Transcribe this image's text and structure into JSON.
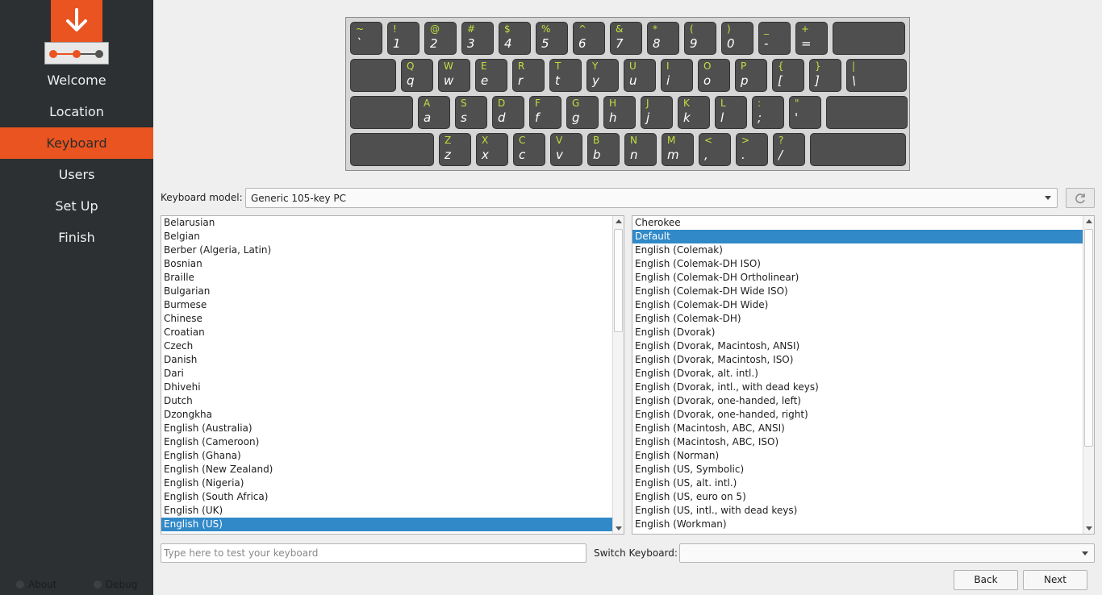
{
  "sidebar": {
    "nav": [
      {
        "label": "Welcome",
        "active": false
      },
      {
        "label": "Location",
        "active": false
      },
      {
        "label": "Keyboard",
        "active": true
      },
      {
        "label": "Users",
        "active": false
      },
      {
        "label": "Set Up",
        "active": false
      },
      {
        "label": "Finish",
        "active": false
      }
    ],
    "about_label": "About",
    "debug_label": "Debug"
  },
  "colors": {
    "accent": "#e95420",
    "sidebar_bg": "#2c3032",
    "selection": "#3189c8",
    "key_bg": "#4f4f4f",
    "key_shift_label": "#bfe040"
  },
  "keyboard_preview": {
    "rows": [
      [
        {
          "shift": "~",
          "base": "`"
        },
        {
          "shift": "!",
          "base": "1"
        },
        {
          "shift": "@",
          "base": "2"
        },
        {
          "shift": "#",
          "base": "3"
        },
        {
          "shift": "$",
          "base": "4"
        },
        {
          "shift": "%",
          "base": "5"
        },
        {
          "shift": "^",
          "base": "6"
        },
        {
          "shift": "&",
          "base": "7"
        },
        {
          "shift": "*",
          "base": "8"
        },
        {
          "shift": "(",
          "base": "9"
        },
        {
          "shift": ")",
          "base": "0"
        },
        {
          "shift": "_",
          "base": "-"
        },
        {
          "shift": "+",
          "base": "="
        },
        {
          "shift": "",
          "base": "",
          "wide": "backspace"
        }
      ],
      [
        {
          "shift": "",
          "base": "",
          "wide": "tab"
        },
        {
          "shift": "Q",
          "base": "q"
        },
        {
          "shift": "W",
          "base": "w"
        },
        {
          "shift": "E",
          "base": "e"
        },
        {
          "shift": "R",
          "base": "r"
        },
        {
          "shift": "T",
          "base": "t"
        },
        {
          "shift": "Y",
          "base": "y"
        },
        {
          "shift": "U",
          "base": "u"
        },
        {
          "shift": "I",
          "base": "i"
        },
        {
          "shift": "O",
          "base": "o"
        },
        {
          "shift": "P",
          "base": "p"
        },
        {
          "shift": "{",
          "base": "["
        },
        {
          "shift": "}",
          "base": "]"
        },
        {
          "shift": "|",
          "base": "\\",
          "wide": "backslash"
        }
      ],
      [
        {
          "shift": "",
          "base": "",
          "wide": "caps"
        },
        {
          "shift": "A",
          "base": "a"
        },
        {
          "shift": "S",
          "base": "s"
        },
        {
          "shift": "D",
          "base": "d"
        },
        {
          "shift": "F",
          "base": "f"
        },
        {
          "shift": "G",
          "base": "g"
        },
        {
          "shift": "H",
          "base": "h"
        },
        {
          "shift": "J",
          "base": "j"
        },
        {
          "shift": "K",
          "base": "k"
        },
        {
          "shift": "L",
          "base": "l"
        },
        {
          "shift": ":",
          "base": ";"
        },
        {
          "shift": "\"",
          "base": "'"
        },
        {
          "shift": "",
          "base": "",
          "wide": "enter"
        }
      ],
      [
        {
          "shift": "",
          "base": "",
          "wide": "lshift"
        },
        {
          "shift": "Z",
          "base": "z"
        },
        {
          "shift": "X",
          "base": "x"
        },
        {
          "shift": "C",
          "base": "c"
        },
        {
          "shift": "V",
          "base": "v"
        },
        {
          "shift": "B",
          "base": "b"
        },
        {
          "shift": "N",
          "base": "n"
        },
        {
          "shift": "M",
          "base": "m"
        },
        {
          "shift": "<",
          "base": ","
        },
        {
          "shift": ">",
          "base": "."
        },
        {
          "shift": "?",
          "base": "/"
        },
        {
          "shift": "",
          "base": "",
          "wide": "rshift"
        }
      ]
    ]
  },
  "keyboard_model": {
    "label": "Keyboard model:",
    "value": "Generic 105-key PC"
  },
  "layouts": {
    "items": [
      "Belarusian",
      "Belgian",
      "Berber (Algeria, Latin)",
      "Bosnian",
      "Braille",
      "Bulgarian",
      "Burmese",
      "Chinese",
      "Croatian",
      "Czech",
      "Danish",
      "Dari",
      "Dhivehi",
      "Dutch",
      "Dzongkha",
      "English (Australia)",
      "English (Cameroon)",
      "English (Ghana)",
      "English (New Zealand)",
      "English (Nigeria)",
      "English (South Africa)",
      "English (UK)",
      "English (US)"
    ],
    "selected": "English (US)"
  },
  "variants": {
    "items": [
      "Cherokee",
      "Default",
      "English (Colemak)",
      "English (Colemak-DH ISO)",
      "English (Colemak-DH Ortholinear)",
      "English (Colemak-DH Wide ISO)",
      "English (Colemak-DH Wide)",
      "English (Colemak-DH)",
      "English (Dvorak)",
      "English (Dvorak, Macintosh, ANSI)",
      "English (Dvorak, Macintosh, ISO)",
      "English (Dvorak, alt. intl.)",
      "English (Dvorak, intl., with dead keys)",
      "English (Dvorak, one-handed, left)",
      "English (Dvorak, one-handed, right)",
      "English (Macintosh, ABC, ANSI)",
      "English (Macintosh, ABC, ISO)",
      "English (Norman)",
      "English (US, Symbolic)",
      "English (US, alt. intl.)",
      "English (US, euro on 5)",
      "English (US, intl., with dead keys)",
      "English (Workman)"
    ],
    "selected": "Default"
  },
  "test_input": {
    "placeholder": "Type here to test your keyboard",
    "value": ""
  },
  "switch_keyboard": {
    "label": "Switch Keyboard:",
    "value": ""
  },
  "buttons": {
    "back": "Back",
    "next": "Next"
  },
  "icons": {
    "logo": "download-arrow-icon",
    "refresh": "refresh-icon"
  }
}
